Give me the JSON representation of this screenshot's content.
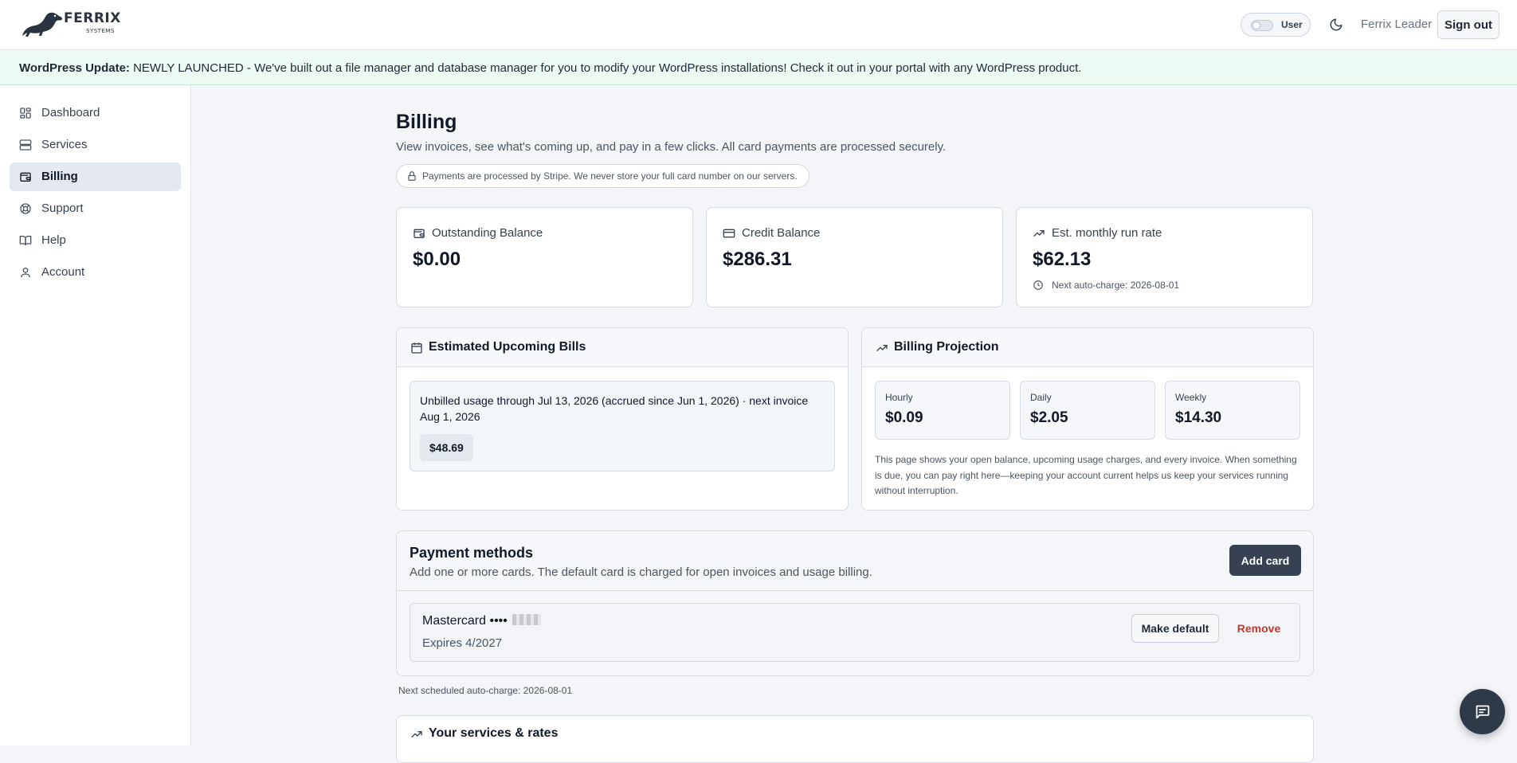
{
  "brand": {
    "name": "FERRIX",
    "tagline": "SYSTEMS"
  },
  "header": {
    "role_label": "User",
    "user_name": "Ferrix Leader",
    "signout_label": "Sign out"
  },
  "banner": {
    "label": "WordPress Update:",
    "message": "NEWLY LAUNCHED - We've built out a file manager and database manager for you to modify your WordPress installations! Check it out in your portal with any WordPress product."
  },
  "sidebar": {
    "items": [
      {
        "label": "Dashboard",
        "icon": "dashboard-icon"
      },
      {
        "label": "Services",
        "icon": "server-icon"
      },
      {
        "label": "Billing",
        "icon": "wallet-icon",
        "active": true
      },
      {
        "label": "Support",
        "icon": "lifebuoy-icon"
      },
      {
        "label": "Help",
        "icon": "book-icon"
      },
      {
        "label": "Account",
        "icon": "user-icon"
      }
    ]
  },
  "page": {
    "title": "Billing",
    "subtitle": "View invoices, see what's coming up, and pay in a few clicks. All card payments are processed securely.",
    "secure_note": "Payments are processed by Stripe. We never store your full card number on our servers."
  },
  "stats": [
    {
      "label": "Outstanding Balance",
      "value": "$0.00",
      "icon": "wallet-icon"
    },
    {
      "label": "Credit Balance",
      "value": "$286.31",
      "icon": "credit-card-icon"
    },
    {
      "label": "Est. monthly run rate",
      "value": "$62.13",
      "icon": "trending-up-icon",
      "note": "Next auto-charge: 2026-08-01"
    }
  ],
  "upcoming": {
    "title": "Estimated Upcoming Bills",
    "description": "Unbilled usage through Jul 13, 2026 (accrued since Jun 1, 2026) · next invoice Aug 1, 2026",
    "amount": "$48.69"
  },
  "projection": {
    "title": "Billing Projection",
    "items": [
      {
        "label": "Hourly",
        "value": "$0.09"
      },
      {
        "label": "Daily",
        "value": "$2.05"
      },
      {
        "label": "Weekly",
        "value": "$14.30"
      }
    ],
    "description": "This page shows your open balance, upcoming usage charges, and every invoice. When something is due, you can pay right here—keeping your account current helps us keep your services running without interruption."
  },
  "payment_methods": {
    "title": "Payment methods",
    "subtitle": "Add one or more cards. The default card is charged for open invoices and usage billing.",
    "add_label": "Add card",
    "cards": [
      {
        "name": "Mastercard ••••",
        "expires": "Expires 4/2027",
        "make_default_label": "Make default",
        "remove_label": "Remove"
      }
    ],
    "next_charge": "Next scheduled auto-charge: 2026-08-01"
  },
  "services": {
    "title": "Your services & rates"
  },
  "colors": {
    "accent": "#374151",
    "danger": "#c0392b",
    "banner_bg": "#ecfaf3",
    "active_nav": "#e4e9f1"
  }
}
